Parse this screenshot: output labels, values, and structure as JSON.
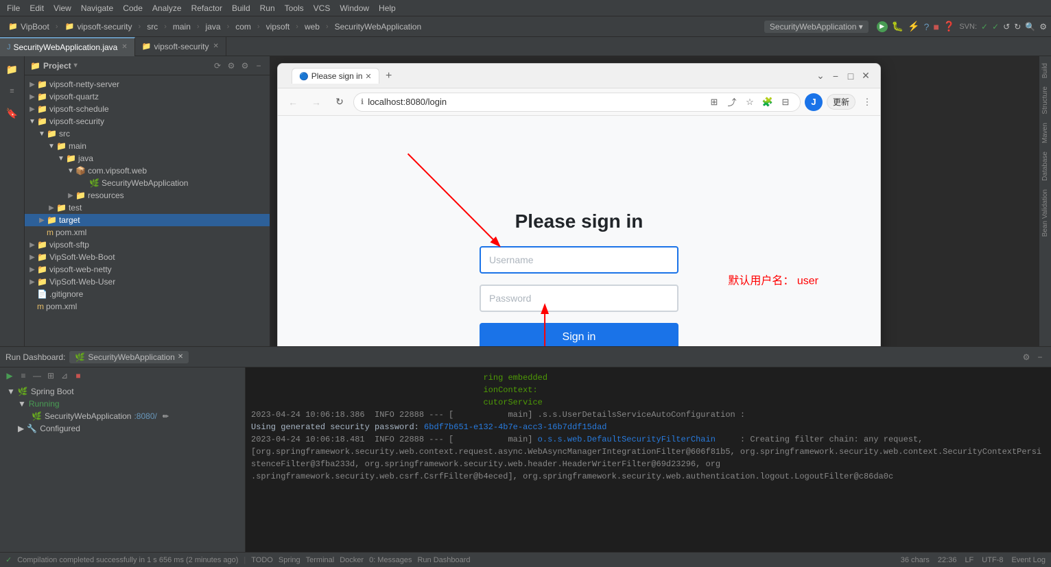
{
  "menu": {
    "items": [
      "File",
      "Edit",
      "View",
      "Navigate",
      "Code",
      "Analyze",
      "Refactor",
      "Build",
      "Run",
      "Tools",
      "VCS",
      "Window",
      "Help"
    ]
  },
  "breadcrumbs": {
    "items": [
      "VipBoot",
      "vipsoft-security",
      "src",
      "main",
      "java",
      "com",
      "vipsoft",
      "web",
      "SecurityWebApplication"
    ]
  },
  "tabs": {
    "editor": [
      {
        "label": "SecurityWebApplication.java",
        "active": true
      },
      {
        "label": "vipsoft-security",
        "active": false
      }
    ]
  },
  "sidebar": {
    "title": "Project",
    "tree": [
      {
        "label": "vipsoft-netty-server",
        "depth": 0,
        "type": "folder",
        "open": false
      },
      {
        "label": "vipsoft-quartz",
        "depth": 0,
        "type": "folder",
        "open": false
      },
      {
        "label": "vipsoft-schedule",
        "depth": 0,
        "type": "folder",
        "open": false
      },
      {
        "label": "vipsoft-security",
        "depth": 0,
        "type": "folder",
        "open": true
      },
      {
        "label": "src",
        "depth": 1,
        "type": "folder",
        "open": true
      },
      {
        "label": "main",
        "depth": 2,
        "type": "folder",
        "open": true
      },
      {
        "label": "java",
        "depth": 3,
        "type": "folder",
        "open": true
      },
      {
        "label": "com.vipsoft.web",
        "depth": 4,
        "type": "package",
        "open": true
      },
      {
        "label": "SecurityWebApplication",
        "depth": 5,
        "type": "java"
      },
      {
        "label": "resources",
        "depth": 4,
        "type": "folder",
        "open": false
      },
      {
        "label": "test",
        "depth": 2,
        "type": "folder",
        "open": false
      },
      {
        "label": "target",
        "depth": 1,
        "type": "folder",
        "open": false,
        "selected": true
      },
      {
        "label": "pom.xml",
        "depth": 1,
        "type": "xml"
      },
      {
        "label": "vipsoft-sftp",
        "depth": 0,
        "type": "folder",
        "open": false
      },
      {
        "label": "VipSoft-Web-Boot",
        "depth": 0,
        "type": "folder",
        "open": false
      },
      {
        "label": "vipsoft-web-netty",
        "depth": 0,
        "type": "folder",
        "open": false
      },
      {
        "label": "VipSoft-Web-User",
        "depth": 0,
        "type": "folder",
        "open": false
      },
      {
        "label": ".gitignore",
        "depth": 0,
        "type": "file"
      },
      {
        "label": "pom.xml",
        "depth": 0,
        "type": "xml"
      }
    ]
  },
  "browser": {
    "title": "Please sign in",
    "url": "localhost:8080/login",
    "tab_label": "Please sign in",
    "login": {
      "heading": "Please sign in",
      "username_placeholder": "Username",
      "password_placeholder": "Password",
      "btn_label": "Sign in",
      "hint": "默认用户名：  user"
    }
  },
  "run_dashboard": {
    "label": "Run Dashboard:",
    "app_name": "SecurityWebApplication",
    "spring_boot_label": "Spring Boot",
    "running_label": "Running",
    "app_running": "SecurityWebApplication",
    "port": ":8080/",
    "configured_label": "Configured"
  },
  "console": {
    "lines": [
      "2023-04-24 10:06:18.386  INFO 22888 --- [           main] .s.s.UserDetailsServiceAutoConfiguration :",
      "",
      "Using generated security password: 6bdf7b651-e132-4b7e-acc3-16b7ddf15dad",
      "",
      "2023-04-24 10:06:18.481  INFO 22888 --- [           main] o.s.s.web.DefaultSecurityFilterChain     : Creating filter chain: any request,",
      "[org.springframework.security.web.context.request.async.WebAsyncManagerIntegrationFilter@606f81b5, org.springframework.security.web.context.SecurityContextPersistenceFilter@3fba233d, org.springframework.security.web.header.HeaderWriterFilter@69d23296, org",
      ".springframework.security.web.csrf.CsrfFilter@b4eced], org.springframework.security.web.authentication.logout.LogoutFilter@c86da0c"
    ],
    "log_lines_above": [
      "ring embedded",
      "ionContext:",
      "cutorService"
    ]
  },
  "status_bar": {
    "message": "Compilation completed successfully in 1 s 656 ms (2 minutes ago)",
    "todo": "TODO",
    "spring": "Spring",
    "terminal": "Terminal",
    "docker": "Docker",
    "messages": "0: Messages",
    "run_dashboard": "Run Dashboard",
    "chars": "36 chars",
    "line_col": "22:36",
    "lf": "LF",
    "encoding": "UTF-8",
    "event_log": "Event Log"
  },
  "right_panel_tabs": [
    "Build",
    "Structure",
    "Maven",
    "Database",
    "Bean Validation"
  ],
  "password_field_value": ""
}
